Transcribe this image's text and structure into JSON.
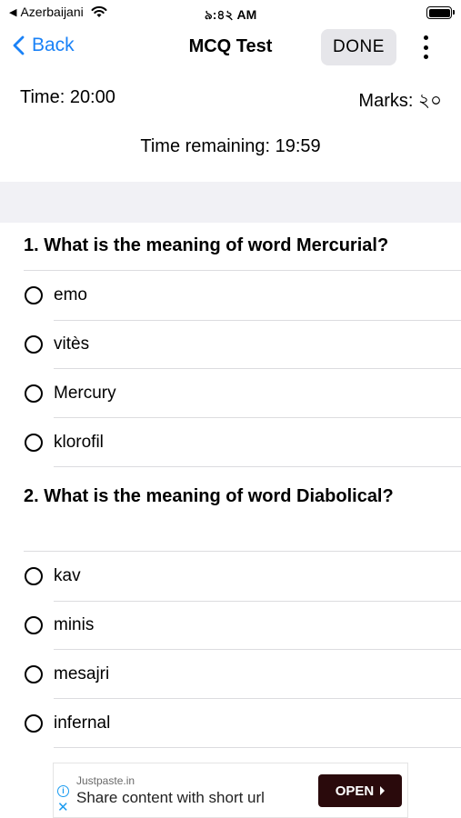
{
  "status_bar": {
    "carrier": "Azerbaijani",
    "time": "৯:৪২ AM"
  },
  "nav": {
    "back_label": "Back",
    "title": "MCQ Test",
    "done_label": "DONE"
  },
  "test_info": {
    "time": "Time: 20:00",
    "marks": "Marks: ২০",
    "remaining": "Time remaining: 19:59"
  },
  "questions": [
    {
      "text": "1. What is the meaning of word Mercurial?",
      "options": [
        "emo",
        "vitès",
        "Mercury",
        "klorofil"
      ]
    },
    {
      "text": "2. What is the meaning of word Diabolical?",
      "options": [
        "kav",
        "minis",
        "mesajri",
        "infernal"
      ]
    }
  ],
  "ad": {
    "source": "Justpaste.in",
    "headline": "Share content with short url",
    "cta": "OPEN"
  }
}
